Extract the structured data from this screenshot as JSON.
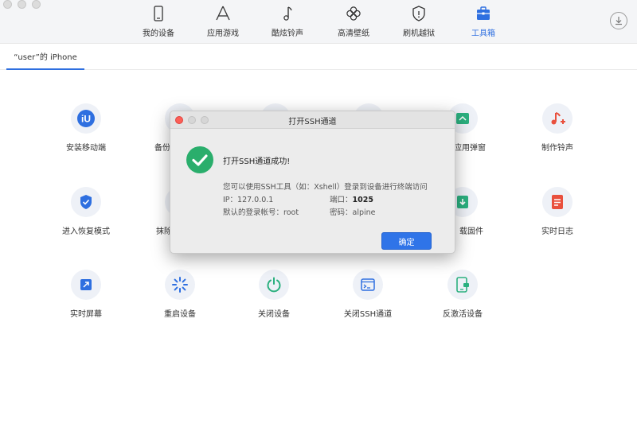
{
  "nav": {
    "items": [
      {
        "label": "我的设备",
        "icon": "phone-icon"
      },
      {
        "label": "应用游戏",
        "icon": "app-store-icon"
      },
      {
        "label": "酷炫铃声",
        "icon": "music-note-icon"
      },
      {
        "label": "高清壁纸",
        "icon": "flower-icon"
      },
      {
        "label": "刷机越狱",
        "icon": "shield-icon"
      },
      {
        "label": "工具箱",
        "icon": "toolbox-icon"
      }
    ],
    "active": "工具箱",
    "accent": "#2e6fe0"
  },
  "device_tab": {
    "label": "“user”的 iPhone"
  },
  "tools": {
    "install_app": "安装移动端",
    "backup": "备份",
    "app_popup": "应用弹窗",
    "make_ringtone": "制作铃声",
    "recovery_mode": "进入恢复模式",
    "erase": "抹除",
    "download_firmware": "载固件",
    "realtime_log": "实时日志",
    "realtime_screen": "实时屏幕",
    "reboot": "重启设备",
    "shutdown": "关闭设备",
    "close_ssh": "关闭SSH通道",
    "deactivate": "反激活设备"
  },
  "dialog": {
    "title": "打开SSH通道",
    "success": "打开SSH通道成功!",
    "hint": "您可以使用SSH工具（如：Xshell）登录到设备进行终端访问",
    "ip_label": "IP：",
    "ip_value": "127.0.0.1",
    "port_label": "端口：",
    "port_value": "1025",
    "account_label": "默认的登录帐号：",
    "account_value": "root",
    "password_label": "密码：",
    "password_value": "alpine",
    "ok": "确定"
  }
}
